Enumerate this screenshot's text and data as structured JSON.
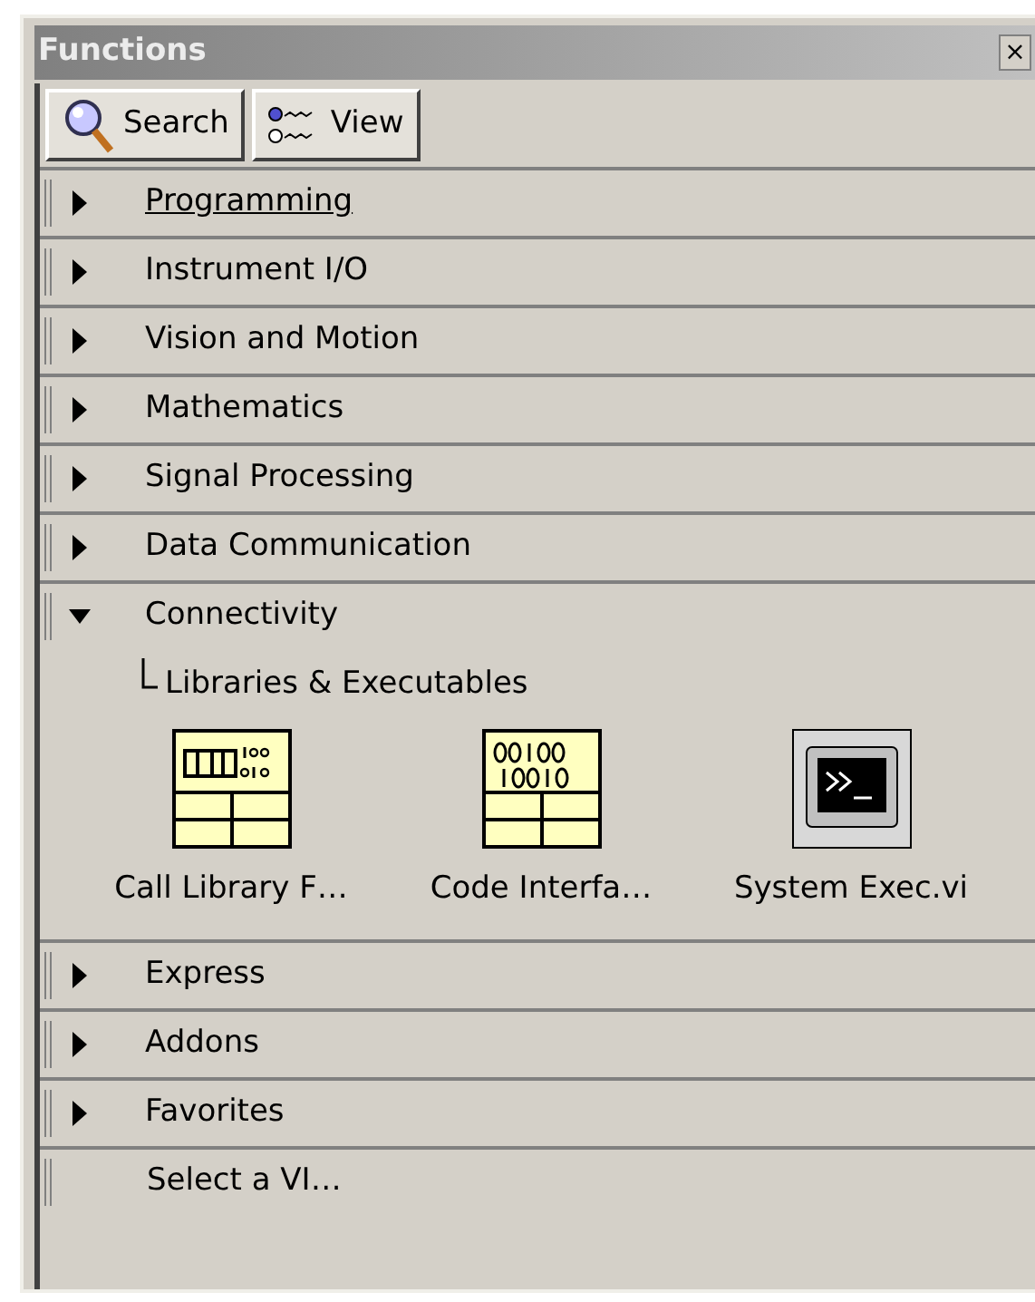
{
  "window": {
    "title": "Functions",
    "close": "×"
  },
  "toolbar": [
    {
      "kind": "search",
      "label": "Search"
    },
    {
      "kind": "view",
      "label": "View"
    }
  ],
  "categories": [
    {
      "kind": "category",
      "label": "Programming",
      "expanded": false,
      "highlighted": true
    },
    {
      "kind": "category",
      "label": "Instrument I/O",
      "expanded": false,
      "highlighted": false
    },
    {
      "kind": "category",
      "label": "Vision and Motion",
      "expanded": false,
      "highlighted": false
    },
    {
      "kind": "category",
      "label": "Mathematics",
      "expanded": false,
      "highlighted": false
    },
    {
      "kind": "category",
      "label": "Signal Processing",
      "expanded": false,
      "highlighted": false
    },
    {
      "kind": "category",
      "label": "Data Communication",
      "expanded": false,
      "highlighted": false
    },
    {
      "kind": "category",
      "label": "Connectivity",
      "expanded": true,
      "highlighted": false,
      "subpalette": "Libraries & Executables",
      "items": [
        {
          "kind": "library",
          "label": "Call Library F…"
        },
        {
          "kind": "code",
          "label": "Code Interfa…"
        },
        {
          "kind": "terminal",
          "label": "System Exec.vi"
        }
      ]
    },
    {
      "kind": "category",
      "label": "Express",
      "expanded": false,
      "highlighted": false
    },
    {
      "kind": "category",
      "label": "Addons",
      "expanded": false,
      "highlighted": false
    },
    {
      "kind": "category",
      "label": "Favorites",
      "expanded": false,
      "highlighted": false
    },
    {
      "kind": "action",
      "label": "Select a VI…"
    }
  ]
}
